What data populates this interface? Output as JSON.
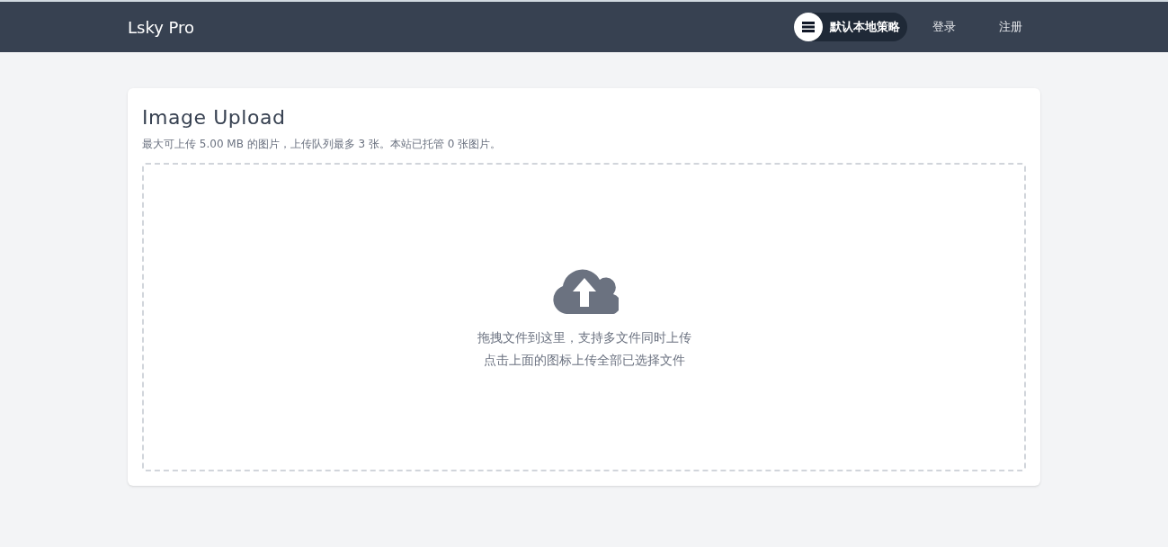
{
  "navbar": {
    "brand": "Lsky Pro",
    "strategy": "默认本地策略",
    "links": [
      "登录",
      "注册"
    ]
  },
  "upload": {
    "title": "Image Upload",
    "info": "最大可上传 5.00 MB 的图片，上传队列最多 3 张。本站已托管 0 张图片。",
    "hints": [
      "拖拽文件到这里，支持多文件同时上传",
      "点击上面的图标上传全部已选择文件"
    ]
  }
}
